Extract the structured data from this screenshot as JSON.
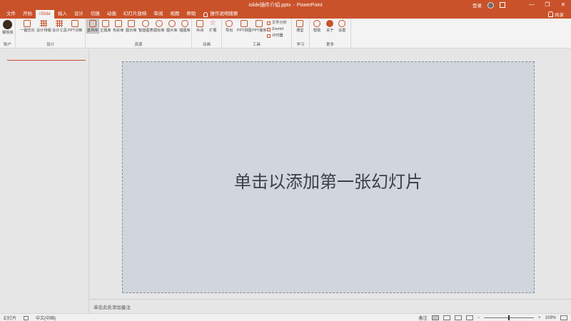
{
  "window": {
    "title_file": "islide插件介绍.pptx",
    "title_sep": "-",
    "title_app": "PowerPoint",
    "user": "登录",
    "controls": [
      "—",
      "❐",
      "✕"
    ]
  },
  "tabs": [
    "文件",
    "开始",
    "iSlide",
    "插入",
    "设计",
    "切换",
    "动画",
    "幻灯片放映",
    "审阅",
    "视图",
    "帮助"
  ],
  "active_tab": "iSlide",
  "search_label": "操作说明搜索",
  "share_label": "共享",
  "ribbon": {
    "groups": [
      {
        "label": "账户",
        "buttons": [
          "钢铁侠"
        ]
      },
      {
        "label": "设计",
        "buttons": [
          "一键优化",
          "设计排版",
          "设计工具",
          "PPT诊断"
        ]
      },
      {
        "label": "资源",
        "buttons": [
          "案例库",
          "主题库",
          "色彩库",
          "图示库",
          "智能图表",
          "图标库",
          "图片库",
          "插图库"
        ]
      },
      {
        "label": "动画",
        "buttons": [
          "补间",
          "扩展"
        ]
      },
      {
        "label": "工具",
        "buttons": [
          "导出",
          "PPT拼图",
          "PPT瘦身"
        ],
        "small": [
          "文件分析",
          "ZoomIt",
          "计时器"
        ]
      },
      {
        "label": "学习",
        "buttons": [
          "课堂"
        ]
      },
      {
        "label": "更多",
        "buttons": [
          "帮助",
          "关于",
          "设置"
        ]
      }
    ]
  },
  "slide": {
    "placeholder": "单击以添加第一张幻灯片"
  },
  "notes_placeholder": "单击此处添加备注",
  "status": {
    "slide_label": "幻灯片",
    "language": "中文(中国)",
    "notes": "备注",
    "zoom": "109%"
  }
}
